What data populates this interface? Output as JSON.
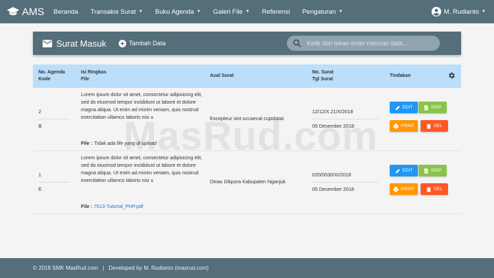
{
  "navbar": {
    "brand": "AMS",
    "menu": [
      {
        "label": "Beranda",
        "dropdown": false
      },
      {
        "label": "Transaksi Surat",
        "dropdown": true
      },
      {
        "label": "Buku Agenda",
        "dropdown": true
      },
      {
        "label": "Galeri File",
        "dropdown": true
      },
      {
        "label": "Referensi",
        "dropdown": false
      },
      {
        "label": "Pengaturan",
        "dropdown": true
      }
    ],
    "user": "M. Rudianto"
  },
  "watermark": "MasRud.com",
  "card": {
    "title": "Surat Masuk",
    "add_label": "Tambah Data",
    "search_placeholder": "Ketik dan tekan enter mencari data..."
  },
  "table": {
    "headers": {
      "col1_line1": "No. Agenda",
      "col1_line2": "Kode",
      "col2_line1": "Isi Ringkas",
      "col2_line2": "File",
      "col3": "Asal Surat",
      "col4_line1": "No. Surat",
      "col4_line2": "Tgl Surat",
      "col5": "Tindakan"
    },
    "file_label": "File :",
    "actions": {
      "edit": "EDIT",
      "disp": "DISP",
      "print": "PRINT",
      "del": "DEL"
    },
    "rows": [
      {
        "no_agenda": "2",
        "kode": "B",
        "isi": "Lorem ipsum dolor sit amet, consectetur adipisicing elit, sed do eiusmod tempor incididunt ut labore et dolore magna aliqua. Ut enim ad minim veniam, quis nostrud exercitation ullamco laboris nisi u",
        "file": "Tidak ada file yang di upload",
        "asal": "Excepteur sint occaecat cupidatat",
        "no_surat": "12/12/X.21/X/2018",
        "tgl_surat": "05 Desember 2018"
      },
      {
        "no_agenda": "1",
        "kode": "E",
        "isi": "Lorem ipsum dolor sit amet, consectetur adipisicing elit, sed do eiusmod tempor incididunt ut labore et dolore magna aliqua. Ut enim ad minim veniam, quis nostrud exercitation ullamco laboris nisi u",
        "file": "7013-Tutorial_PHP.pdf",
        "asal": "Dinas Dikpora Kabupaten Nganjuk",
        "no_surat": "020/0036/XI/2018",
        "tgl_surat": "05 Desember 2018"
      }
    ]
  },
  "footer": "© 2018 SMK MasRud.com   |   Developed by M. Rudianto (masrud.com)",
  "colors": {
    "primary": "#546e7a",
    "table_header": "#bbdefb",
    "edit": "#2196f3",
    "disp": "#8bc34a",
    "print": "#ff9800",
    "del": "#ff5722"
  }
}
